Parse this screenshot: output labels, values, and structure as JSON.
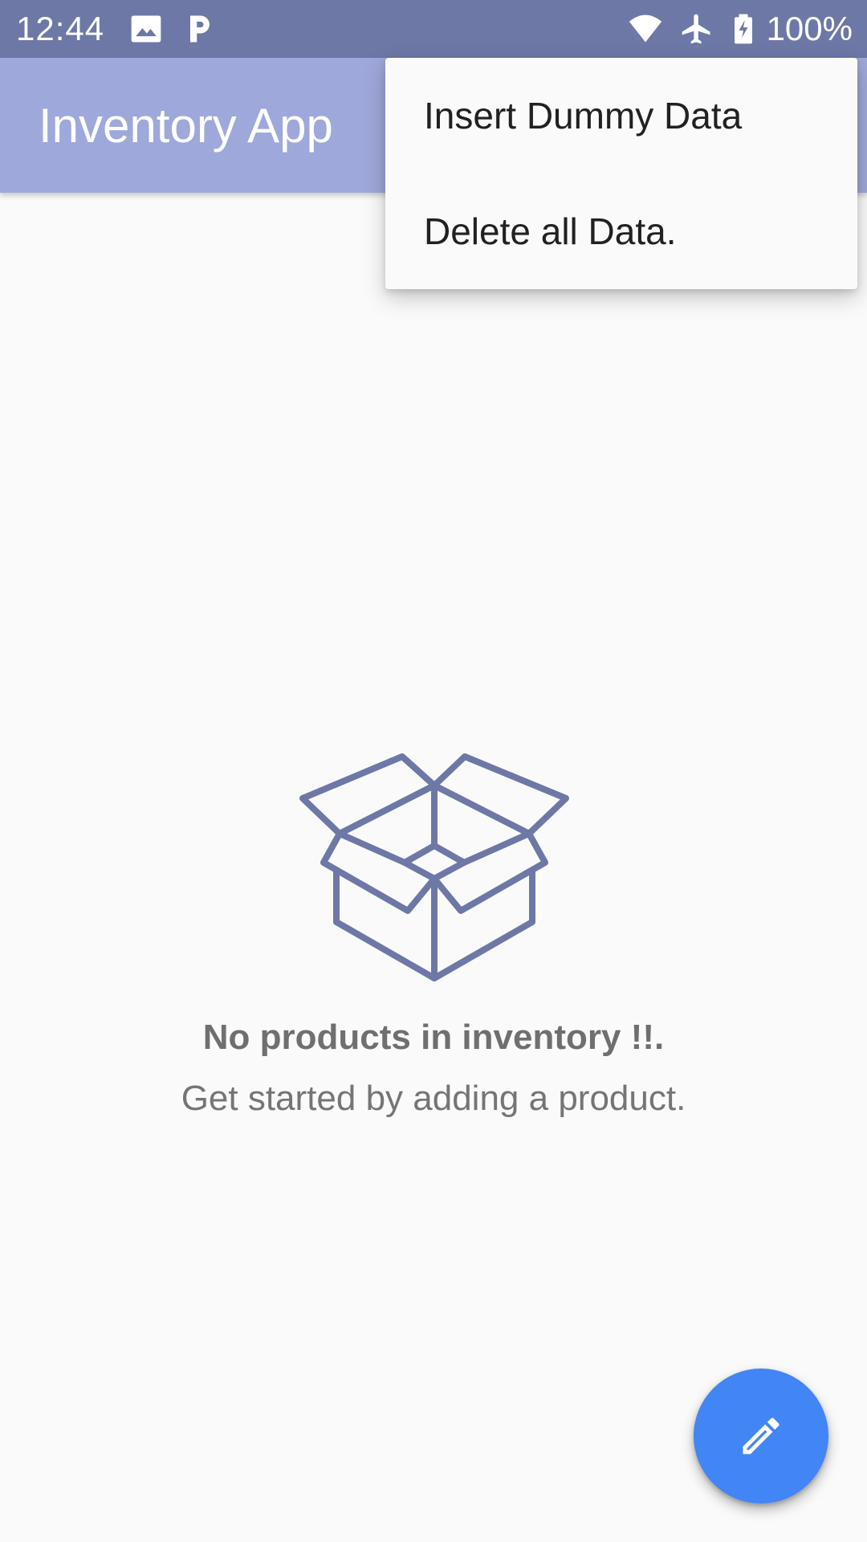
{
  "status_bar": {
    "time": "12:44",
    "battery": "100%",
    "icons": [
      "image-icon",
      "parking-icon",
      "wifi-icon",
      "airplane-icon",
      "battery-charging-icon"
    ]
  },
  "app_bar": {
    "title": "Inventory App"
  },
  "overflow_menu": {
    "items": [
      {
        "label": "Insert Dummy Data"
      },
      {
        "label": "Delete all Data."
      }
    ]
  },
  "empty_state": {
    "icon": "open-box-icon",
    "title": "No products in inventory !!.",
    "subtitle": "Get started by adding a product."
  },
  "fab": {
    "icon": "pencil-icon"
  },
  "colors": {
    "status_bar": "#6e78a7",
    "app_bar": "#9fa8da",
    "illustration": "#6e78a7",
    "fab": "#4285f4",
    "background": "#fafafa"
  }
}
